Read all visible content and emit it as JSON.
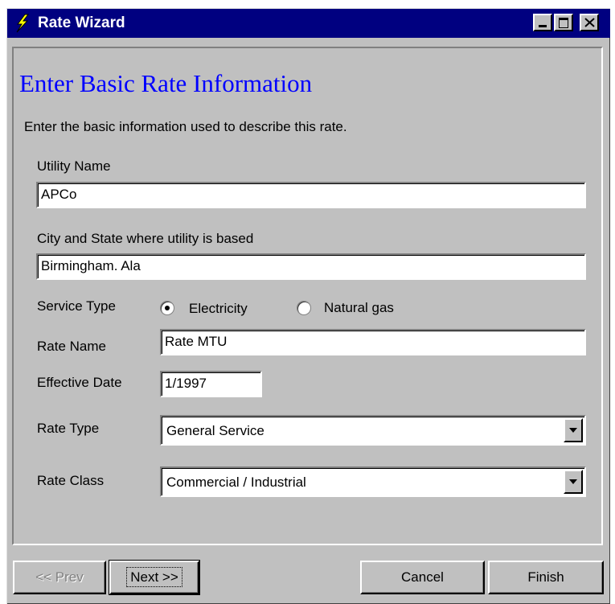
{
  "window": {
    "title": "Rate Wizard"
  },
  "page": {
    "heading": "Enter Basic Rate Information",
    "description": "Enter the basic information used to describe this rate."
  },
  "form": {
    "utility_name": {
      "label": "Utility Name",
      "value": "APCo"
    },
    "city_state": {
      "label": "City and State where utility is based",
      "value": "Birmingham. Ala"
    },
    "service_type": {
      "label": "Service Type",
      "options": [
        {
          "label": "Electricity",
          "checked": true
        },
        {
          "label": "Natural gas",
          "checked": false
        }
      ]
    },
    "rate_name": {
      "label": "Rate Name",
      "value": "Rate MTU"
    },
    "effective_date": {
      "label": "Effective Date",
      "value": "1/1997"
    },
    "rate_type": {
      "label": "Rate Type",
      "value": "General Service"
    },
    "rate_class": {
      "label": "Rate Class",
      "value": "Commercial / Industrial"
    }
  },
  "buttons": {
    "prev": "<< Prev",
    "next": "Next >>",
    "cancel": "Cancel",
    "finish": "Finish"
  },
  "colors": {
    "titlebar": "#000080",
    "heading": "#0000ff",
    "face": "#c0c0c0"
  },
  "icons": {
    "app": "lightning-bolt-icon"
  }
}
